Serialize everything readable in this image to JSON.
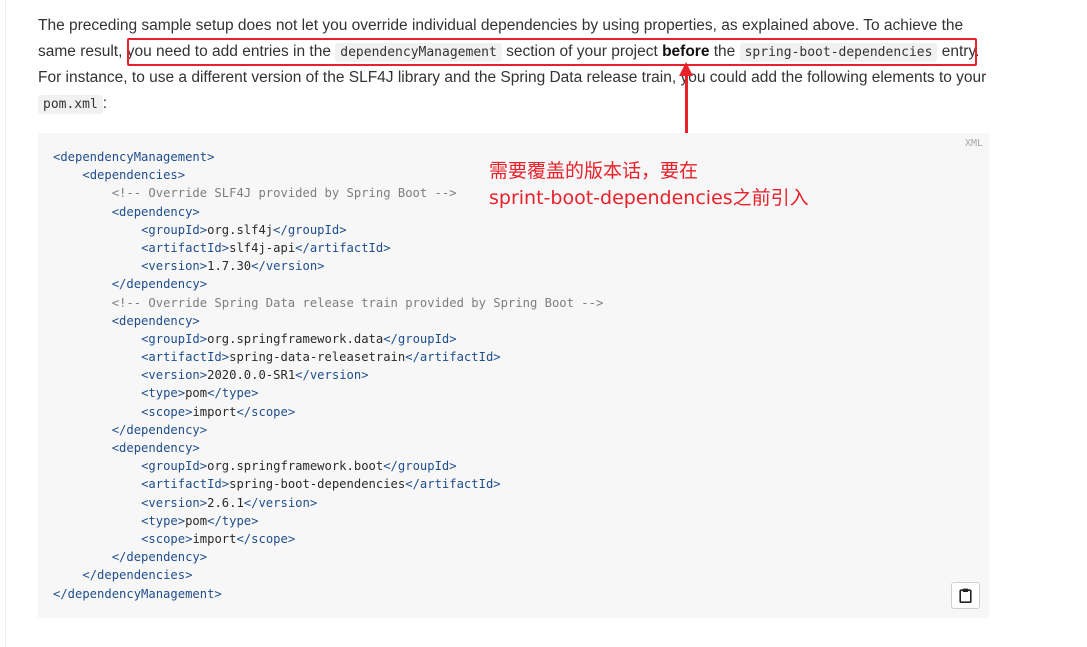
{
  "paragraph": {
    "t1": "The preceding sample setup does not let you override individual dependencies by using properties, as explained above. To achieve the same result, you need to add entries in the ",
    "code1": "dependencyManagement",
    "t2": " section of your project ",
    "bold": "before",
    "t3": " the ",
    "code2": "spring-boot-dependencies",
    "t4": " entry. For instance, to use a different version of the SLF4J library and the Spring Data release train, you could add the following elements to your ",
    "code3": "pom.xml",
    "t5": ":"
  },
  "code_block": {
    "language": "XML",
    "lines": [
      {
        "indent": "",
        "parts": [
          [
            "tag",
            "<dependencyManagement>"
          ]
        ]
      },
      {
        "indent": "    ",
        "parts": [
          [
            "tag",
            "<dependencies>"
          ]
        ]
      },
      {
        "indent": "        ",
        "parts": [
          [
            "cmt",
            "<!-- Override SLF4J provided by Spring Boot -->"
          ]
        ]
      },
      {
        "indent": "        ",
        "parts": [
          [
            "tag",
            "<dependency>"
          ]
        ]
      },
      {
        "indent": "            ",
        "parts": [
          [
            "tag",
            "<groupId>"
          ],
          [
            "val",
            "org.slf4j"
          ],
          [
            "tag",
            "</groupId>"
          ]
        ]
      },
      {
        "indent": "            ",
        "parts": [
          [
            "tag",
            "<artifactId>"
          ],
          [
            "val",
            "slf4j-api"
          ],
          [
            "tag",
            "</artifactId>"
          ]
        ]
      },
      {
        "indent": "            ",
        "parts": [
          [
            "tag",
            "<version>"
          ],
          [
            "val",
            "1.7.30"
          ],
          [
            "tag",
            "</version>"
          ]
        ]
      },
      {
        "indent": "        ",
        "parts": [
          [
            "tag",
            "</dependency>"
          ]
        ]
      },
      {
        "indent": "        ",
        "parts": [
          [
            "cmt",
            "<!-- Override Spring Data release train provided by Spring Boot -->"
          ]
        ]
      },
      {
        "indent": "        ",
        "parts": [
          [
            "tag",
            "<dependency>"
          ]
        ]
      },
      {
        "indent": "            ",
        "parts": [
          [
            "tag",
            "<groupId>"
          ],
          [
            "val",
            "org.springframework.data"
          ],
          [
            "tag",
            "</groupId>"
          ]
        ]
      },
      {
        "indent": "            ",
        "parts": [
          [
            "tag",
            "<artifactId>"
          ],
          [
            "val",
            "spring-data-releasetrain"
          ],
          [
            "tag",
            "</artifactId>"
          ]
        ]
      },
      {
        "indent": "            ",
        "parts": [
          [
            "tag",
            "<version>"
          ],
          [
            "val",
            "2020.0.0-SR1"
          ],
          [
            "tag",
            "</version>"
          ]
        ]
      },
      {
        "indent": "            ",
        "parts": [
          [
            "tag",
            "<type>"
          ],
          [
            "val",
            "pom"
          ],
          [
            "tag",
            "</type>"
          ]
        ]
      },
      {
        "indent": "            ",
        "parts": [
          [
            "tag",
            "<scope>"
          ],
          [
            "val",
            "import"
          ],
          [
            "tag",
            "</scope>"
          ]
        ]
      },
      {
        "indent": "        ",
        "parts": [
          [
            "tag",
            "</dependency>"
          ]
        ]
      },
      {
        "indent": "        ",
        "parts": [
          [
            "tag",
            "<dependency>"
          ]
        ]
      },
      {
        "indent": "            ",
        "parts": [
          [
            "tag",
            "<groupId>"
          ],
          [
            "val",
            "org.springframework.boot"
          ],
          [
            "tag",
            "</groupId>"
          ]
        ]
      },
      {
        "indent": "            ",
        "parts": [
          [
            "tag",
            "<artifactId>"
          ],
          [
            "val",
            "spring-boot-dependencies"
          ],
          [
            "tag",
            "</artifactId>"
          ]
        ]
      },
      {
        "indent": "            ",
        "parts": [
          [
            "tag",
            "<version>"
          ],
          [
            "val",
            "2.6.1"
          ],
          [
            "tag",
            "</version>"
          ]
        ]
      },
      {
        "indent": "            ",
        "parts": [
          [
            "tag",
            "<type>"
          ],
          [
            "val",
            "pom"
          ],
          [
            "tag",
            "</type>"
          ]
        ]
      },
      {
        "indent": "            ",
        "parts": [
          [
            "tag",
            "<scope>"
          ],
          [
            "val",
            "import"
          ],
          [
            "tag",
            "</scope>"
          ]
        ]
      },
      {
        "indent": "        ",
        "parts": [
          [
            "tag",
            "</dependency>"
          ]
        ]
      },
      {
        "indent": "    ",
        "parts": [
          [
            "tag",
            "</dependencies>"
          ]
        ]
      },
      {
        "indent": "",
        "parts": [
          [
            "tag",
            "</dependencyManagement>"
          ]
        ]
      }
    ],
    "copy_icon": "clipboard-icon"
  },
  "annotation": {
    "line1": "需要覆盖的版本话，要在",
    "line2": "sprint-boot-dependencies之前引入",
    "color": "#e8212a"
  }
}
